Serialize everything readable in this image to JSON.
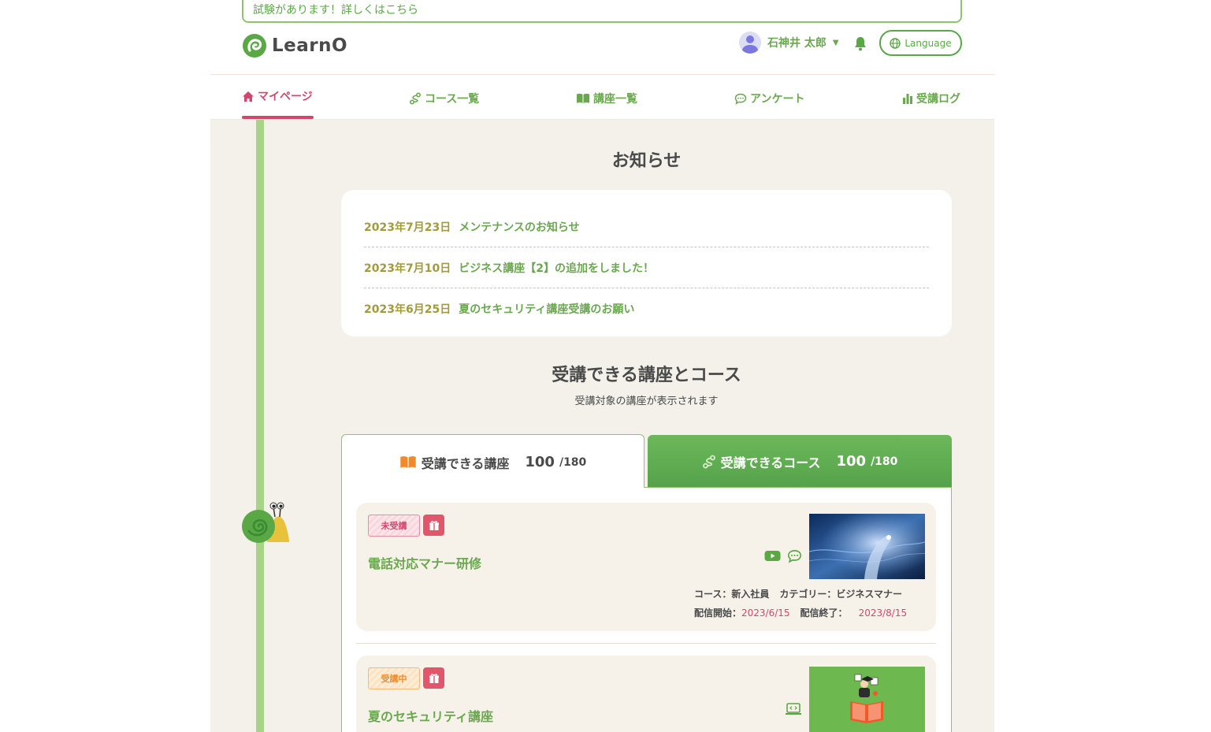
{
  "banner": {
    "text": "試験があります！詳しくはこちら"
  },
  "brand": {
    "name": "LearnO"
  },
  "user": {
    "name": "石神井 太郎"
  },
  "language": {
    "label": "Language"
  },
  "nav": [
    {
      "label": "マイページ",
      "icon": "home-icon",
      "active": true
    },
    {
      "label": "コース一覧",
      "icon": "route-icon"
    },
    {
      "label": "講座一覧",
      "icon": "book-icon"
    },
    {
      "label": "アンケート",
      "icon": "chat-icon"
    },
    {
      "label": "受講ログ",
      "icon": "bar-chart-icon"
    }
  ],
  "news": {
    "title": "お知らせ",
    "items": [
      {
        "date": "2023年7月23日",
        "text": "メンテナンスのお知らせ"
      },
      {
        "date": "2023年7月10日",
        "text": "ビジネス講座【2】の追加をしました！"
      },
      {
        "date": "2023年6月25日",
        "text": "夏のセキュリティ講座受講のお願い"
      }
    ]
  },
  "available": {
    "title": "受講できる講座とコース",
    "subtitle": "受講対象の講座が表示されます"
  },
  "tabs": {
    "lectures": {
      "label": "受講できる講座",
      "count": "100",
      "total": "/180"
    },
    "courses": {
      "label": "受講できるコース",
      "count": "100",
      "total": "/180"
    }
  },
  "lectures": [
    {
      "status": "未受講",
      "title": "電話対応マナー研修",
      "course_label": "コース：新入社員",
      "category_label": "カテゴリー：ビジネスマナー",
      "start_label": "配信開始：",
      "start_date": "2023/6/15",
      "end_label": "配信終了：",
      "end_date": "2023/8/15"
    },
    {
      "status": "受講中",
      "title": "夏のセキュリティ講座"
    }
  ],
  "colors": {
    "green": "#6aa84f",
    "pink": "#d1476f",
    "rail": "#a8d488"
  }
}
